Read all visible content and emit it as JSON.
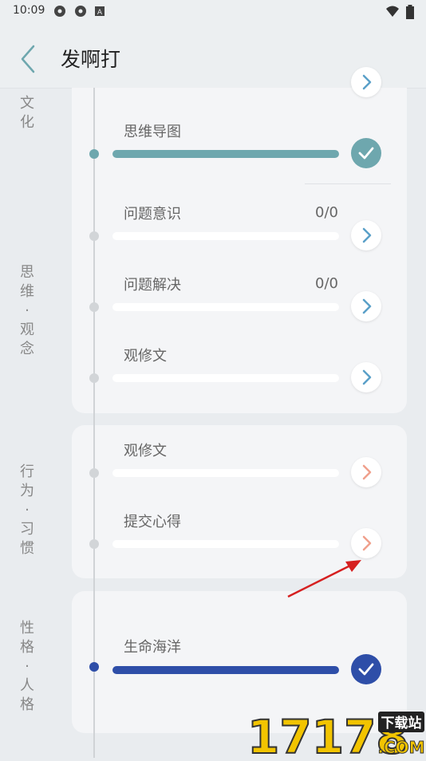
{
  "status_bar": {
    "time": "10:09"
  },
  "header": {
    "title": "发啊打"
  },
  "sections": [
    {
      "label_lines": [
        "文",
        "化"
      ]
    },
    {
      "label_lines": [
        "思",
        "维",
        "·",
        "观",
        "念"
      ]
    },
    {
      "label_lines": [
        "行",
        "为",
        "·",
        "习",
        "惯"
      ]
    },
    {
      "label_lines": [
        "性",
        "格",
        "·",
        "人",
        "格"
      ]
    }
  ],
  "items": [
    {
      "title": "思维导图",
      "count": "",
      "progress": 1.0,
      "status": "done"
    },
    {
      "title": "问题意识",
      "count": "0/0",
      "progress": 0,
      "status": "open"
    },
    {
      "title": "问题解决",
      "count": "0/0",
      "progress": 0,
      "status": "open"
    },
    {
      "title": "观修文",
      "count": "",
      "progress": 0,
      "status": "open"
    },
    {
      "title": "观修文",
      "count": "",
      "progress": 0,
      "status": "open"
    },
    {
      "title": "提交心得",
      "count": "",
      "progress": 0,
      "status": "open"
    },
    {
      "title": "生命海洋",
      "count": "",
      "progress": 1.0,
      "status": "done"
    }
  ],
  "colors": {
    "teal": "#6ea7ae",
    "blue_icon": "#5aa0c8",
    "salmon_icon": "#f0a08c",
    "navy": "#2e4ea8",
    "annotation_arrow": "#d62020"
  },
  "watermark": {
    "number": "17178",
    "tag": "下载站",
    "domain": ".COM"
  }
}
